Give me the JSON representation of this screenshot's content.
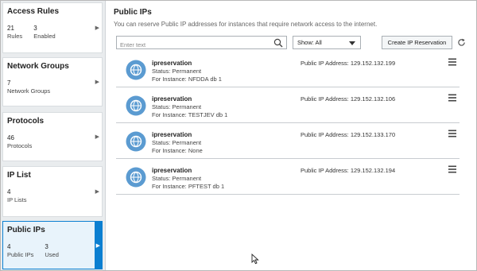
{
  "sidebar": {
    "cards": [
      {
        "title": "Access Rules",
        "stats": [
          {
            "num": "21",
            "label": "Rules"
          },
          {
            "num": "3",
            "label": "Enabled"
          }
        ]
      },
      {
        "title": "Network Groups",
        "stats": [
          {
            "num": "7",
            "label": "Network Groups"
          }
        ]
      },
      {
        "title": "Protocols",
        "stats": [
          {
            "num": "46",
            "label": "Protocols"
          }
        ]
      },
      {
        "title": "IP List",
        "stats": [
          {
            "num": "4",
            "label": "IP Lists"
          }
        ]
      },
      {
        "title": "Public IPs",
        "stats": [
          {
            "num": "4",
            "label": "Public IPs"
          },
          {
            "num": "3",
            "label": "Used"
          }
        ],
        "active": true
      }
    ]
  },
  "main": {
    "title": "Public IPs",
    "subtitle": "You can reserve Public IP addresses for instances that require network access to the internet.",
    "search": {
      "placeholder": "Enter text",
      "value": ""
    },
    "filter": {
      "selected": "Show: All"
    },
    "create_label": "Create IP Reservation",
    "rows": [
      {
        "name": "ipreservation",
        "status": "Status: Permanent",
        "instance": "For Instance: NFDDA db 1",
        "ip": "Public IP Address: 129.152.132.199"
      },
      {
        "name": "ipreservation",
        "status": "Status: Permanent",
        "instance": "For Instance: TESTJEV db 1",
        "ip": "Public IP Address: 129.152.132.106"
      },
      {
        "name": "ipreservation",
        "status": "Status: Permanent",
        "instance": "For Instance: None",
        "ip": "Public IP Address: 129.152.133.170"
      },
      {
        "name": "ipreservation",
        "status": "Status: Permanent",
        "instance": "For Instance: PFTEST db 1",
        "ip": "Public IP Address: 129.152.132.194"
      }
    ]
  },
  "colors": {
    "accent": "#0b7fd1",
    "sidebar_bg": "#e9ecee",
    "avatar": "#5b9bd1"
  },
  "icons": [
    "search-icon",
    "caret-down-icon",
    "refresh-icon",
    "globe-icon",
    "hamburger-menu-icon",
    "chevron-right-icon",
    "mouse-cursor-icon"
  ]
}
